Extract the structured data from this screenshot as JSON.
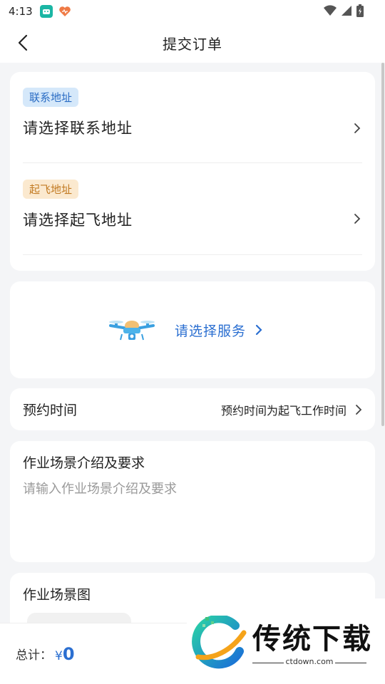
{
  "status_bar": {
    "time": "4:13"
  },
  "nav": {
    "title": "提交订单"
  },
  "contact_address": {
    "tag": "联系地址",
    "placeholder_text": "请选择联系地址"
  },
  "takeoff_address": {
    "tag": "起飞地址",
    "placeholder_text": "请选择起飞地址"
  },
  "service": {
    "label": "请选择服务"
  },
  "booking": {
    "label": "预约时间",
    "value": "预约时间为起飞工作时间"
  },
  "scene_description": {
    "title": "作业场景介绍及要求",
    "placeholder": "请输入作业场景介绍及要求"
  },
  "scene_image": {
    "title": "作业场景图"
  },
  "footer": {
    "total_label": "总计：",
    "currency": "¥",
    "amount": "0"
  },
  "watermark": {
    "brand": "传统下载",
    "site": "ctdown.com"
  },
  "colors": {
    "accent": "#2b6fd1",
    "contact_tag_bg": "#d5e8fa",
    "takeoff_tag_bg": "#fbe9cf",
    "page_bg": "#f4f5f7"
  }
}
